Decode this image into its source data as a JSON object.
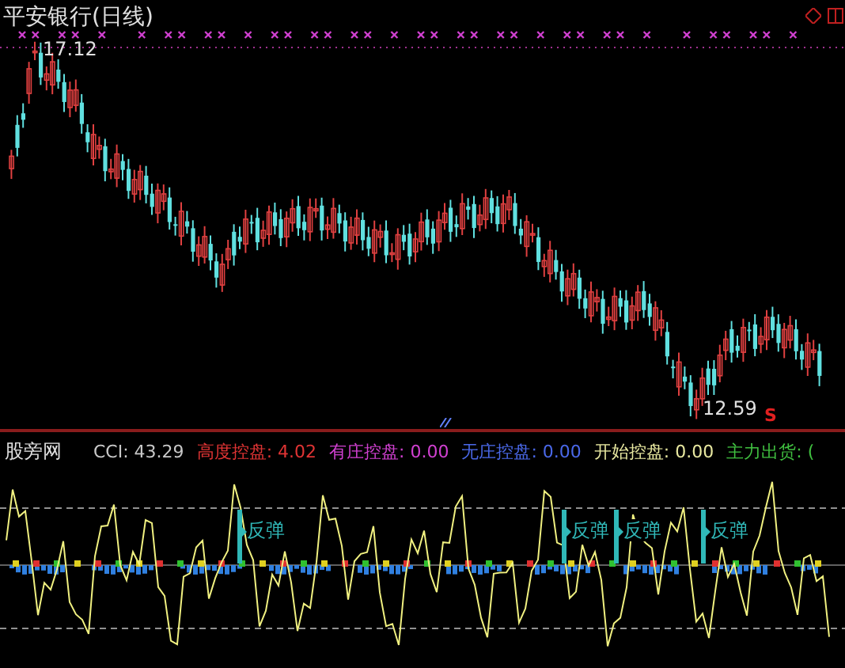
{
  "chart": {
    "title": "平安银行(日线)",
    "high_label": "17.12",
    "low_label": "12.59",
    "signal_mark": "S"
  },
  "indicator": {
    "name": "股旁网",
    "values": [
      {
        "text": "CCI: 43.29",
        "color": "#c8c8c8"
      },
      {
        "text": "高度控盘: 4.02",
        "color": "#e03434"
      },
      {
        "text": "有庄控盘: 0.00",
        "color": "#d040d0"
      },
      {
        "text": "无庄控盘: 0.00",
        "color": "#4a68e8"
      },
      {
        "text": "开始控盘: 0.00",
        "color": "#e8e8a0"
      },
      {
        "text": "主力出货: (",
        "color": "#40c040"
      }
    ]
  },
  "signals": [
    {
      "label": "反弹"
    },
    {
      "label": "反弹"
    },
    {
      "label": "反弹"
    },
    {
      "label": "反弹"
    }
  ]
}
